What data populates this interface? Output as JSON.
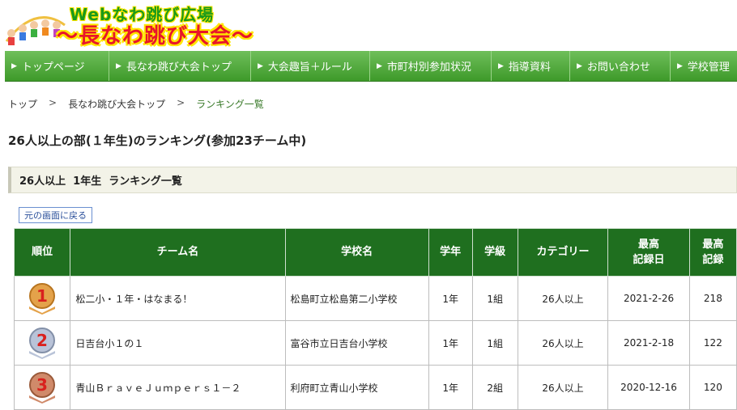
{
  "header": {
    "logo_line1": "Webなわ跳び広場",
    "logo_line2": "～長なわ跳び大会～"
  },
  "nav": {
    "items": [
      {
        "label": "トップページ"
      },
      {
        "label": "長なわ跳び大会トップ"
      },
      {
        "label": "大会趣旨＋ルール"
      },
      {
        "label": "市町村別参加状況"
      },
      {
        "label": "指導資料"
      },
      {
        "label": "お問い合わせ"
      },
      {
        "label": "学校管理"
      }
    ]
  },
  "breadcrumb": {
    "items": [
      "トップ",
      "長なわ跳び大会トップ",
      "ランキング一覧"
    ],
    "separator": ">"
  },
  "page_title": "26人以上の部(１年生)のランキング(参加23チーム中)",
  "section_title": "26人以上  1年生  ランキング一覧",
  "back_button": "元の画面に戻る",
  "table": {
    "headers": {
      "rank": "順位",
      "team": "チーム名",
      "school": "学校名",
      "grade": "学年",
      "class": "学級",
      "category": "カテゴリー",
      "best_date_1": "最高",
      "best_date_2": "記録日",
      "best_record_1": "最高",
      "best_record_2": "記録"
    },
    "rows": [
      {
        "rank": "1",
        "medal_color": "#e4a24a",
        "team": "松二小・１年・はなまる！",
        "school": "松島町立松島第二小学校",
        "grade": "1年",
        "class": "1組",
        "category": "26人以上",
        "date": "2021-2-26",
        "record": "218"
      },
      {
        "rank": "2",
        "medal_color": "#b9c3d8",
        "team": "日吉台小１の１",
        "school": "富谷市立日吉台小学校",
        "grade": "1年",
        "class": "1組",
        "category": "26人以上",
        "date": "2021-2-18",
        "record": "122"
      },
      {
        "rank": "3",
        "medal_color": "#d08a6a",
        "team": "青山ＢｒａｖｅＪｕｍｐｅｒｓ１－２",
        "school": "利府町立青山小学校",
        "grade": "1年",
        "class": "2組",
        "category": "26人以上",
        "date": "2020-12-16",
        "record": "120"
      }
    ]
  },
  "colors": {
    "nav_green": "#4ea83a",
    "table_header_green": "#1f6f1f",
    "rank_number_red": "#d9211e"
  }
}
